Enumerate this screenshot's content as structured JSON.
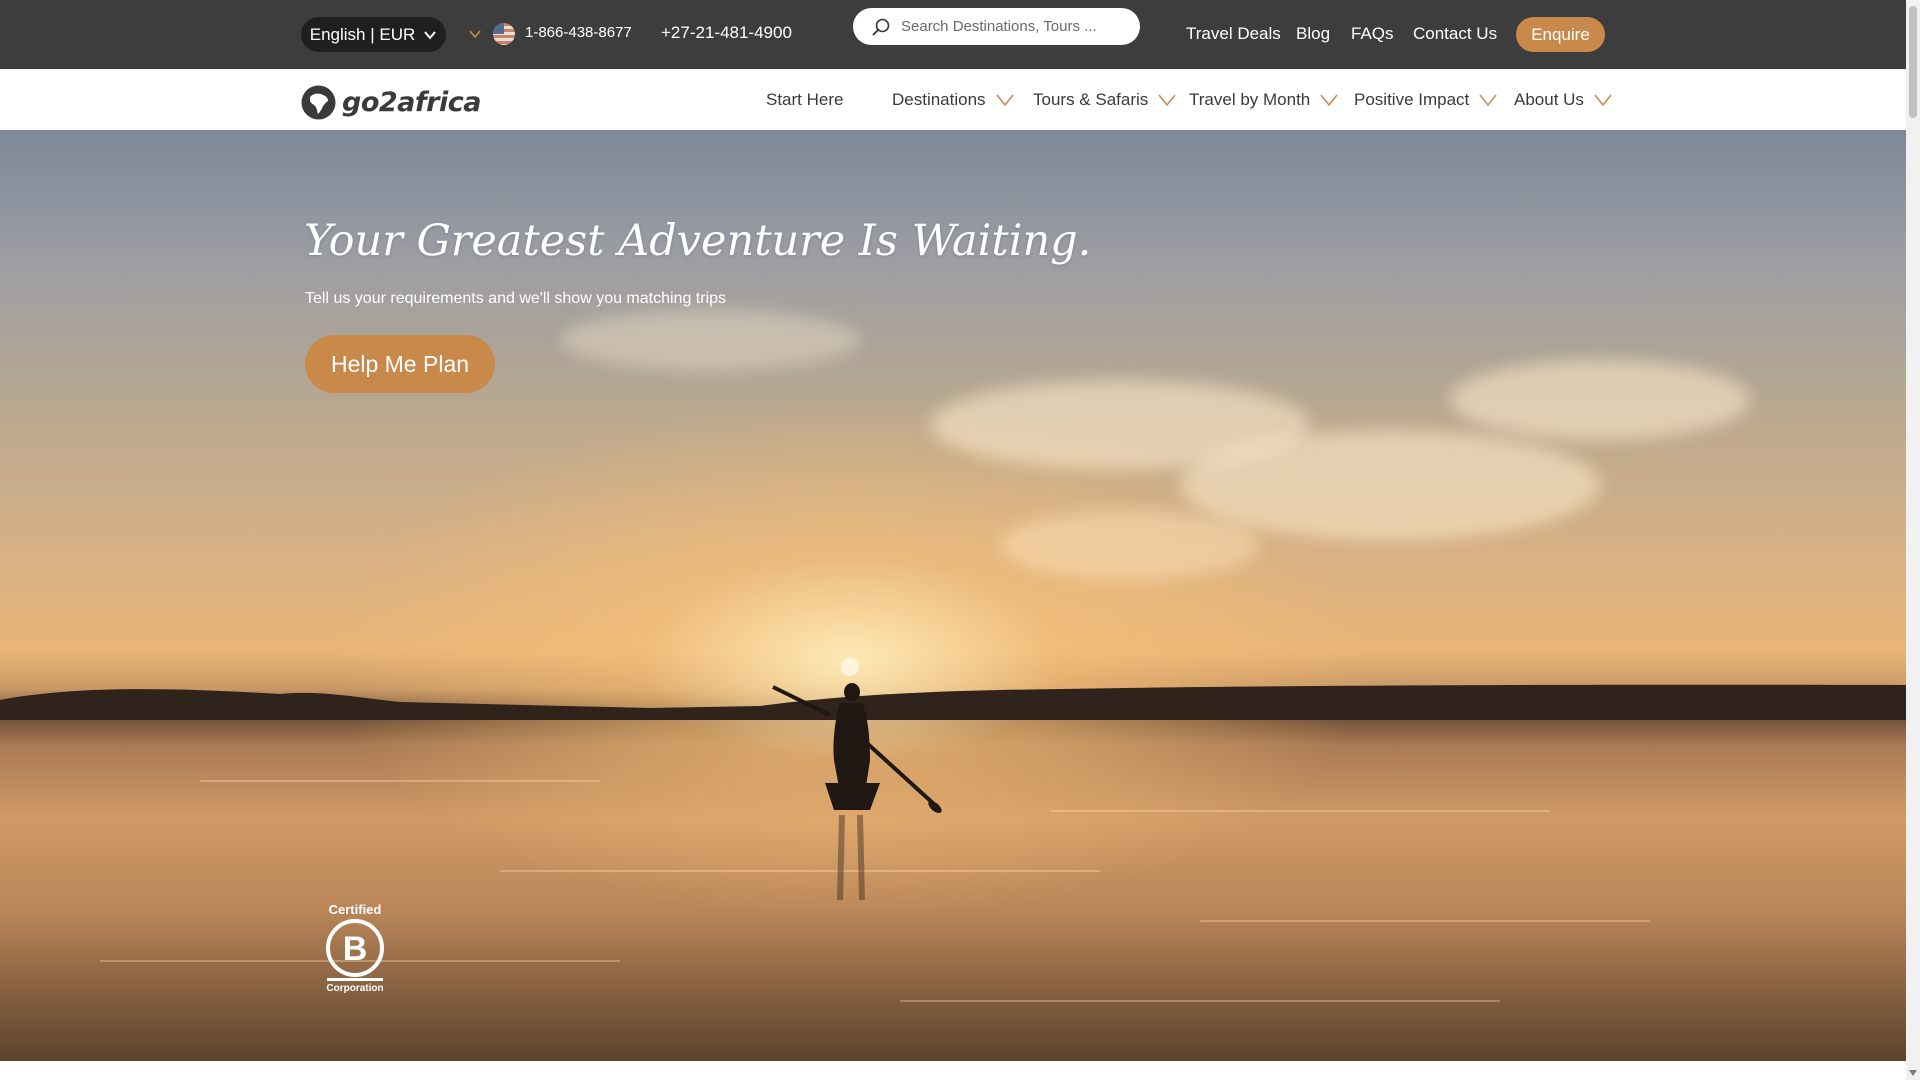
{
  "topbar": {
    "language_label": "English | EUR",
    "phone_primary": "1-866-438-8677",
    "phone_secondary": "+27-21-481-4900",
    "search_placeholder": "Search Destinations, Tours ...",
    "links": [
      "Travel Deals",
      "Blog",
      "FAQs",
      "Contact Us"
    ],
    "enquire_label": "Enquire",
    "flag_icon": "us-flag-icon"
  },
  "nav": {
    "logo_text": "go2africa",
    "items": [
      "Start Here",
      "Destinations",
      "Tours & Safaris",
      "Travel by Month",
      "Positive Impact",
      "About Us"
    ]
  },
  "hero": {
    "title": "Your Greatest Adventure Is Waiting.",
    "subtitle": "Tell us your requirements and we'll show you matching trips",
    "cta_label": "Help Me Plan"
  },
  "badge": {
    "top_text": "Certified",
    "letter": "B",
    "bottom_text": "Corporation"
  },
  "colors": {
    "accent": "#c8894a",
    "topbar_bg": "#3d3d3d",
    "nav_text": "#3a3a3a"
  }
}
